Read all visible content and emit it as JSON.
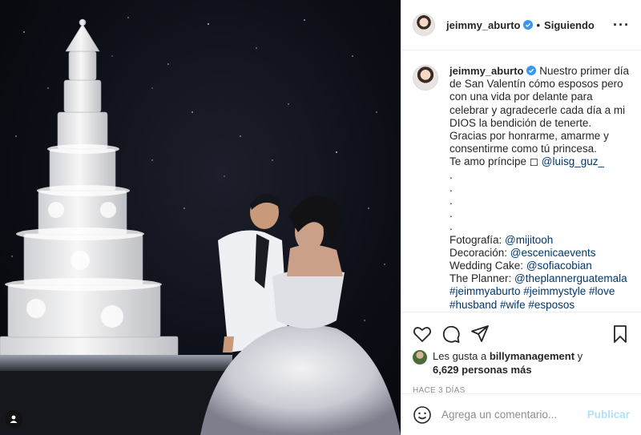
{
  "author": {
    "username": "jeimmy_aburto",
    "follow_status": "Siguiendo",
    "more_icon": "more-options-icon"
  },
  "caption": {
    "username": "jeimmy_aburto",
    "text_1": "Nuestro primer día de San Valentín cómo esposos pero con una vida por delante para celebrar y agradecerle cada día a mi DIOS la bendición de tenerte. Gracias por honrarme, amarme y consentirme como tú princesa.",
    "text_2": "Te amo príncipe ◻ ",
    "mention_1": "@luisg_guz_",
    "dots": ".\n.\n.\n.\n.",
    "credit_photo_label": "Fotografía: ",
    "credit_photo": "@mijitooh",
    "credit_deco_label": "Decoración: ",
    "credit_deco": "@escenicaevents",
    "credit_cake_label": "Wedding Cake: ",
    "credit_cake": "@sofiacobian",
    "credit_planner_label": "The Planner: ",
    "credit_planner": "@theplannerguatemala",
    "hashtags": "#jeimmyaburto #jeimmystyle #love #husband #wife #esposos"
  },
  "likes": {
    "prefix": "Les gusta a ",
    "user": "billymanagement",
    "joiner": " y",
    "count": "6,629 personas más"
  },
  "timestamp": "HACE 3 DÍAS",
  "comment": {
    "placeholder": "Agrega un comentario...",
    "publish": "Publicar"
  },
  "colors": {
    "verified": "#3897f0",
    "link": "#00376b",
    "publish_disabled": "#b2dffc",
    "meta": "#8e8e8e"
  }
}
